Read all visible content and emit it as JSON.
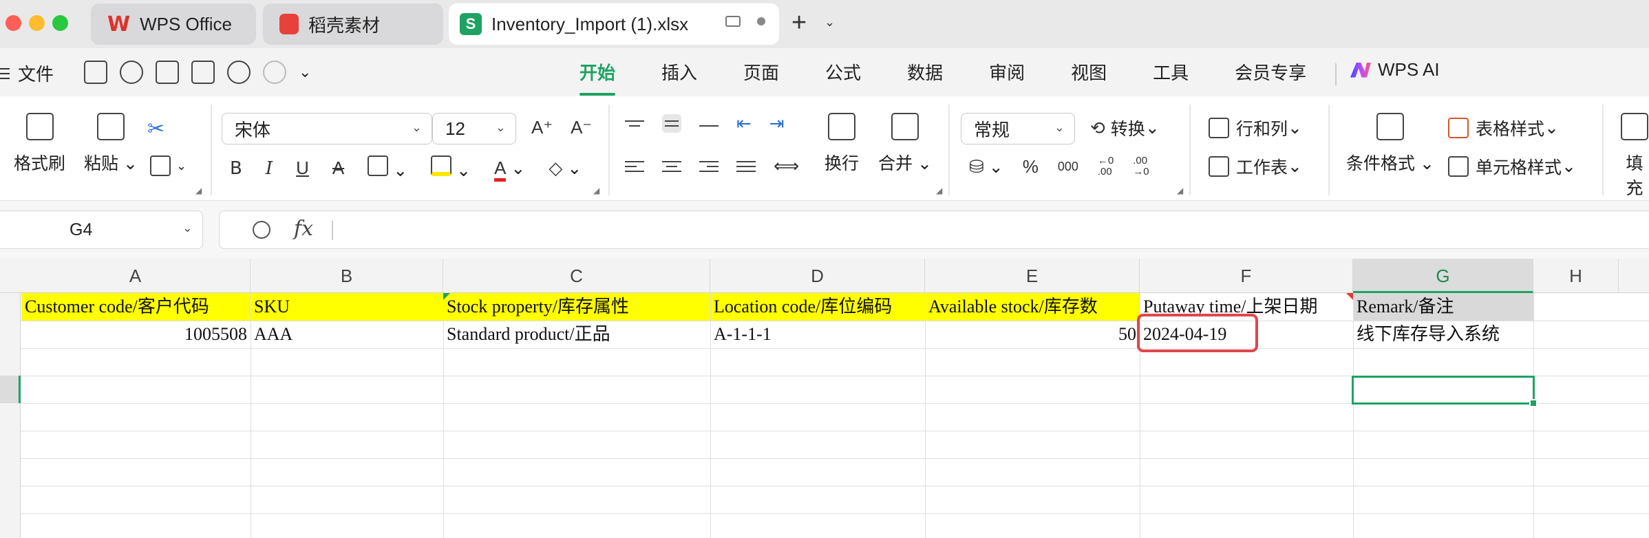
{
  "tabs": {
    "wps": "WPS Office",
    "daoke": "稻壳素材",
    "file": "Inventory_Import (1).xlsx",
    "s_letter": "S",
    "new_tab": "+",
    "new_tab_caret": "⌄"
  },
  "menubar": {
    "file": "文件",
    "tabs": [
      "开始",
      "插入",
      "页面",
      "公式",
      "数据",
      "审阅",
      "视图",
      "工具",
      "会员专享"
    ],
    "active_tab": "开始",
    "wps_ai": "WPS AI"
  },
  "ribbon": {
    "format_painter": "格式刷",
    "paste": "粘贴",
    "font_name": "宋体",
    "font_size": "12",
    "wrap": "换行",
    "merge": "合并",
    "number_format": "常规",
    "convert": "转换",
    "rows_cols": "行和列",
    "worksheet": "工作表",
    "conditional_format": "条件格式",
    "table_style": "表格样式",
    "cell_style": "单元格样式",
    "fill": "填充",
    "percent": "%",
    "thousands": "000",
    "dec_dec": "←0\n.00",
    "dec_inc": ".00\n→0",
    "bold": "B",
    "italic": "I",
    "underline": "U",
    "strike": "A",
    "font_color_letter": "A",
    "font_color": "#e02020",
    "highlight_color": "#ffe600",
    "accent": "#1ea262"
  },
  "formula_bar": {
    "cell_ref": "G4",
    "fx": "fx",
    "content": ""
  },
  "sheet": {
    "columns": [
      "A",
      "B",
      "C",
      "D",
      "E",
      "F",
      "G",
      "H"
    ],
    "active_column": "G",
    "header_row": [
      "Customer code/客户代码",
      "SKU",
      "Stock property/库存属性",
      "Location code/库位编码",
      "Available stock/库存数",
      "Putaway time/上架日期",
      "Remark/备注"
    ],
    "data_row": [
      "1005508",
      "AAA",
      "Standard product/正品",
      "A-1-1-1",
      "50",
      "2024-04-19",
      "线下库存导入系统"
    ],
    "header_fill": "#ffff00",
    "highlight_outline": "#e0474c"
  }
}
